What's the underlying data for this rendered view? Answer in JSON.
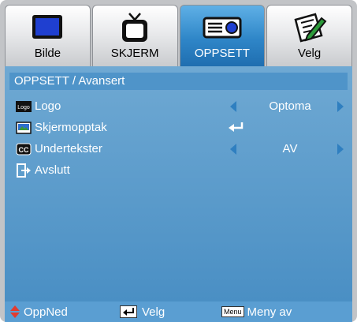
{
  "tabs": [
    {
      "label": "Bilde",
      "icon": "monitor-icon"
    },
    {
      "label": "SKJERM",
      "icon": "tv-icon"
    },
    {
      "label": "OPPSETT",
      "icon": "projector-icon",
      "active": true
    },
    {
      "label": "Velg",
      "icon": "options-pencil-icon"
    }
  ],
  "panel": {
    "title": "OPPSETT / Avansert",
    "rows": [
      {
        "label": "Logo",
        "icon": "logo-icon",
        "icon_text": "Logo",
        "value": "Optoma",
        "control": "selector"
      },
      {
        "label": "Skjermopptak",
        "icon": "screen-capture-icon",
        "control": "enter"
      },
      {
        "label": "Undertekster",
        "icon": "closed-caption-icon",
        "icon_text": "CC",
        "value": "AV",
        "control": "selector"
      },
      {
        "label": "Avslutt",
        "icon": "exit-icon",
        "control": "none"
      }
    ]
  },
  "helpbar": {
    "updown": "OppNed",
    "select": "Velg",
    "menu_key": "Menu",
    "menu_off": "Meny av"
  },
  "colors": {
    "panel": "#4a8fc4",
    "active_tab": "#2f86c8",
    "arrow": "#2f7fc0",
    "updown_arrow": "#e23b2f"
  }
}
